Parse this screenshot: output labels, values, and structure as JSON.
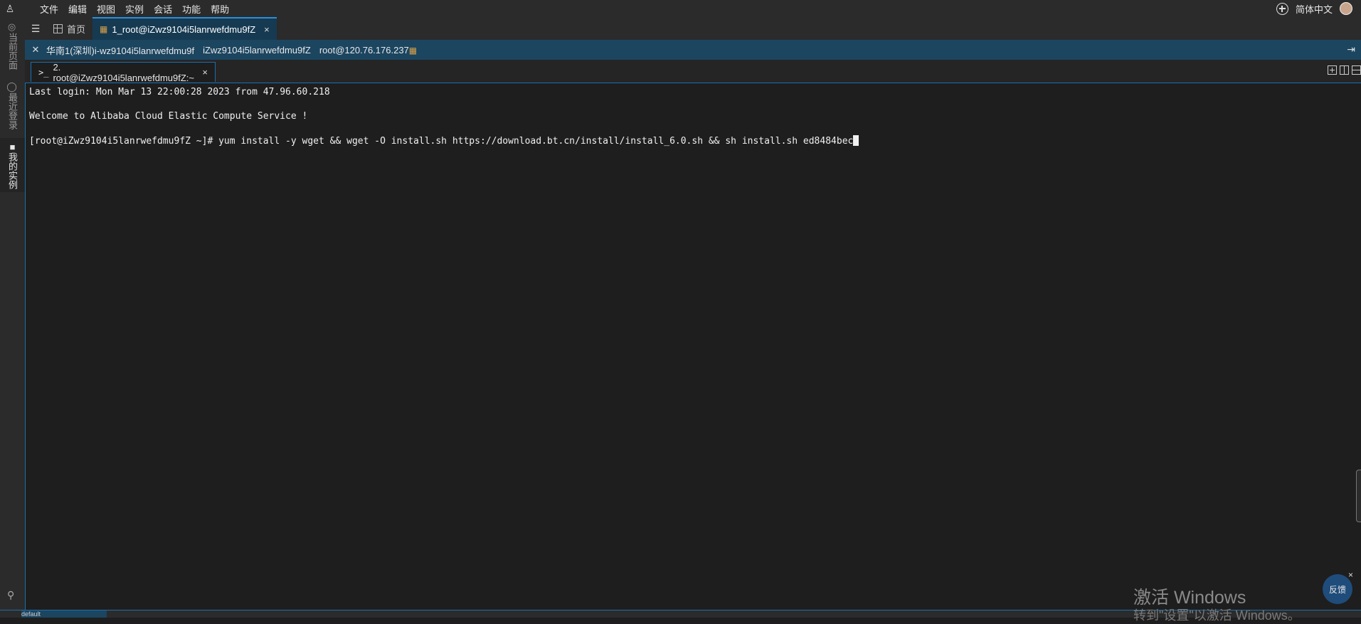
{
  "menubar": {
    "logo_glyph": "♙",
    "items": [
      "文件",
      "编辑",
      "视图",
      "实例",
      "会话",
      "功能",
      "帮助"
    ],
    "language": "简体中文"
  },
  "sidebar": {
    "items": [
      {
        "label": "◎当前页面",
        "active": false
      },
      {
        "label": "◯最近登录",
        "active": false
      },
      {
        "label": "■我的实例",
        "active": true
      }
    ],
    "pin_glyph": "⚲"
  },
  "tabbar1": {
    "menu_glyph": "☰",
    "home_label": "首页",
    "active_tab_label": "1_root@iZwz9104i5lanrwefdmu9fZ",
    "close_glyph": "×"
  },
  "infobar": {
    "collapse_glyph": "✕",
    "region_instance": "华南1(深圳)i-wz9104i5lanrwefdmu9f",
    "hostname": "iZwz9104i5lanrwefdmu9fZ",
    "connection": "root@120.76.176.237",
    "right_glyph": "⇥"
  },
  "tabbar2": {
    "prompt_glyph": ">_",
    "tab_label": "2. root@iZwz9104i5lanrwefdmu9fZ:~",
    "close_glyph": "×"
  },
  "terminal": {
    "lines": [
      "Last login: Mon Mar 13 22:00:28 2023 from 47.96.60.218",
      "Welcome to Alibaba Cloud Elastic Compute Service !",
      "[root@iZwz9104i5lanrwefdmu9fZ ~]# yum install -y wget && wget -O install.sh https://download.bt.cn/install/install_6.0.sh && sh install.sh ed8484bec"
    ]
  },
  "bottombar": {
    "item_label": "default"
  },
  "overlay": {
    "watermark_title": "激活 Windows",
    "watermark_subtitle": "转到\"设置\"以激活 Windows。",
    "feedback_label": "反馈",
    "feedback_close": "×"
  }
}
